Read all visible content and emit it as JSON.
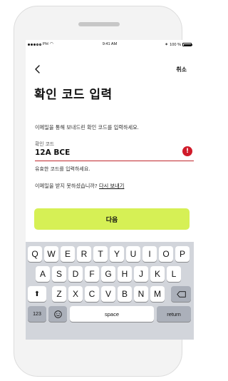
{
  "statusbar": {
    "carrier": "PH",
    "time": "9:41 AM",
    "battery": "100 %"
  },
  "header": {
    "cancel_label": "취소",
    "title": "확인 코드 입력"
  },
  "form": {
    "instruction": "이메일을 통해 보내드린 확인 코드를 입력하세요.",
    "field_label": "확인 코드",
    "code_value": "12A BCE",
    "error_icon_glyph": "!",
    "error_message": "유효한 코드를 입력하세요.",
    "resend_prompt": "이메일을 받지 못하셨습니까? ",
    "resend_link": "다시 보내기"
  },
  "next_button_label": "다음",
  "keyboard": {
    "row1": [
      "Q",
      "W",
      "E",
      "R",
      "T",
      "Y",
      "U",
      "I",
      "O",
      "P"
    ],
    "row2": [
      "A",
      "S",
      "D",
      "F",
      "G",
      "H",
      "J",
      "K",
      "L"
    ],
    "row3": [
      "Z",
      "X",
      "C",
      "V",
      "B",
      "N",
      "M"
    ],
    "numbers_label": "123",
    "space_label": "space",
    "return_label": "return"
  },
  "colors": {
    "accent": "#d6f055",
    "error": "#d01b2a"
  }
}
